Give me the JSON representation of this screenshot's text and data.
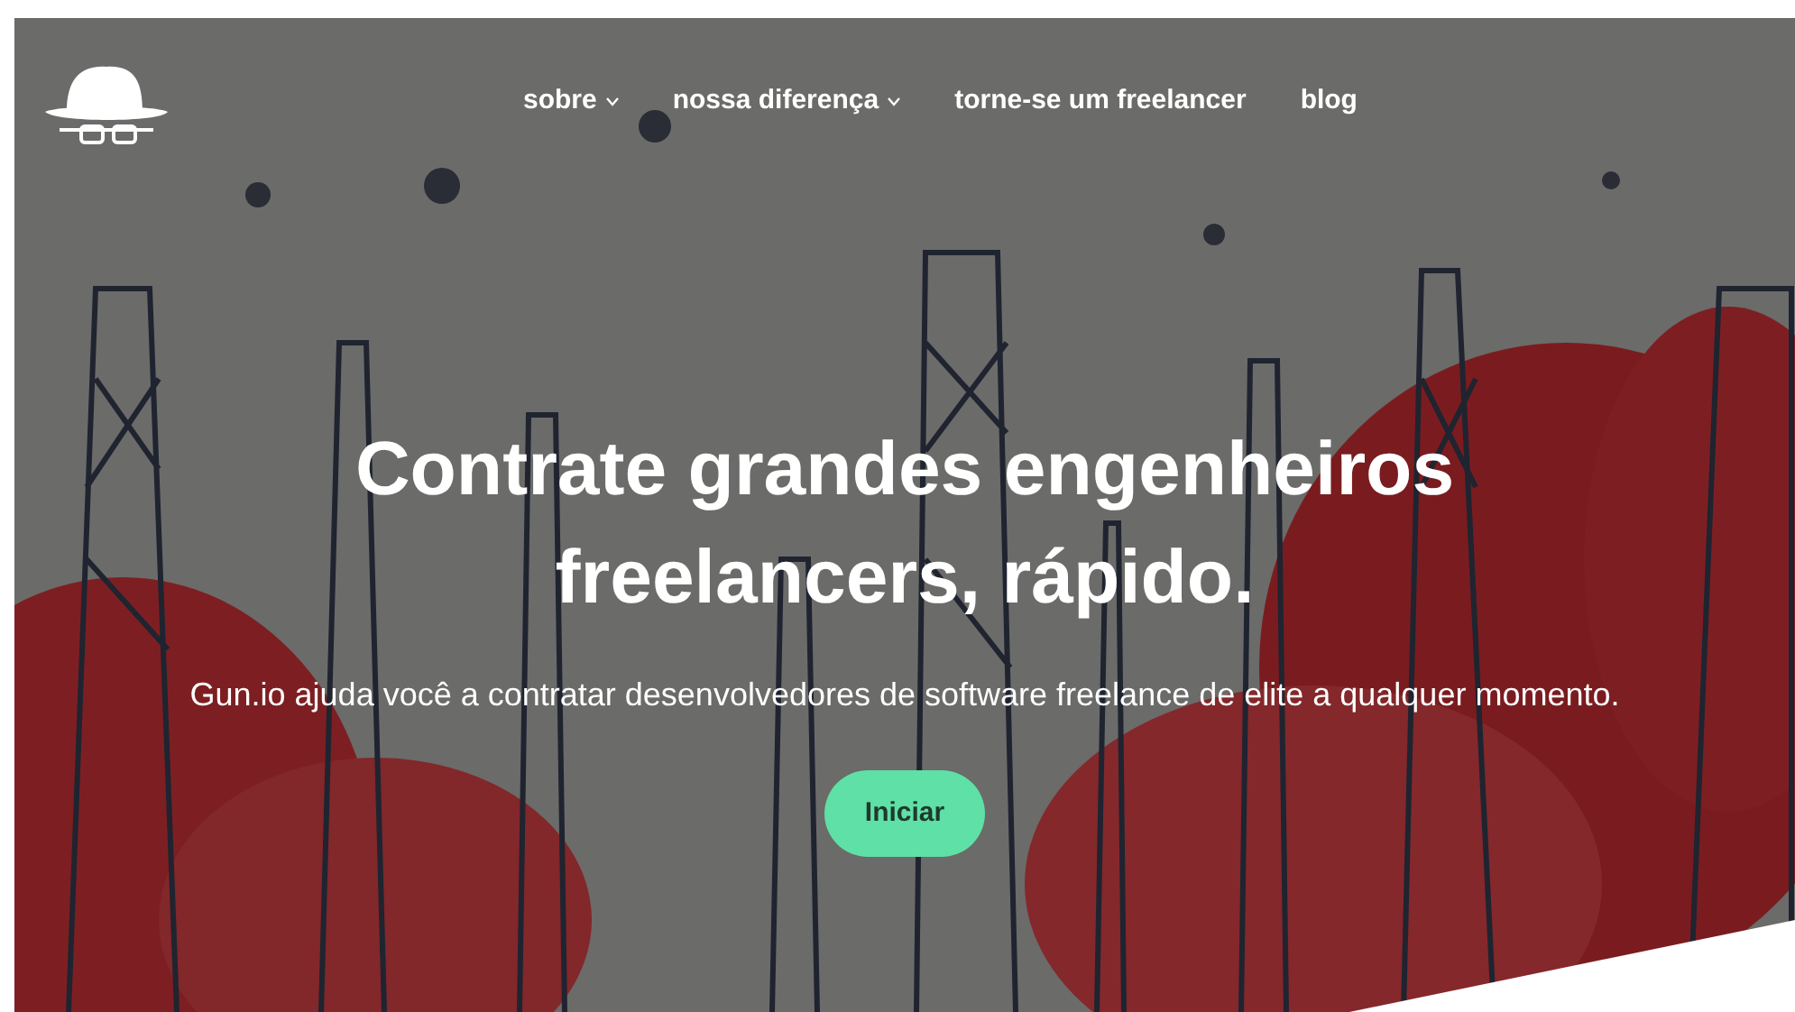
{
  "nav": {
    "items": [
      {
        "label": "sobre",
        "dropdown": true
      },
      {
        "label": "nossa diferença",
        "dropdown": true
      },
      {
        "label": "torne-se um freelancer",
        "dropdown": false
      },
      {
        "label": "blog",
        "dropdown": false
      }
    ]
  },
  "hero": {
    "title": "Contrate grandes engenheiros freelancers, rápido.",
    "subtitle": "Gun.io ajuda você a contratar desenvolvedores de software freelance de elite a qualquer momento.",
    "button": "Iniciar"
  }
}
